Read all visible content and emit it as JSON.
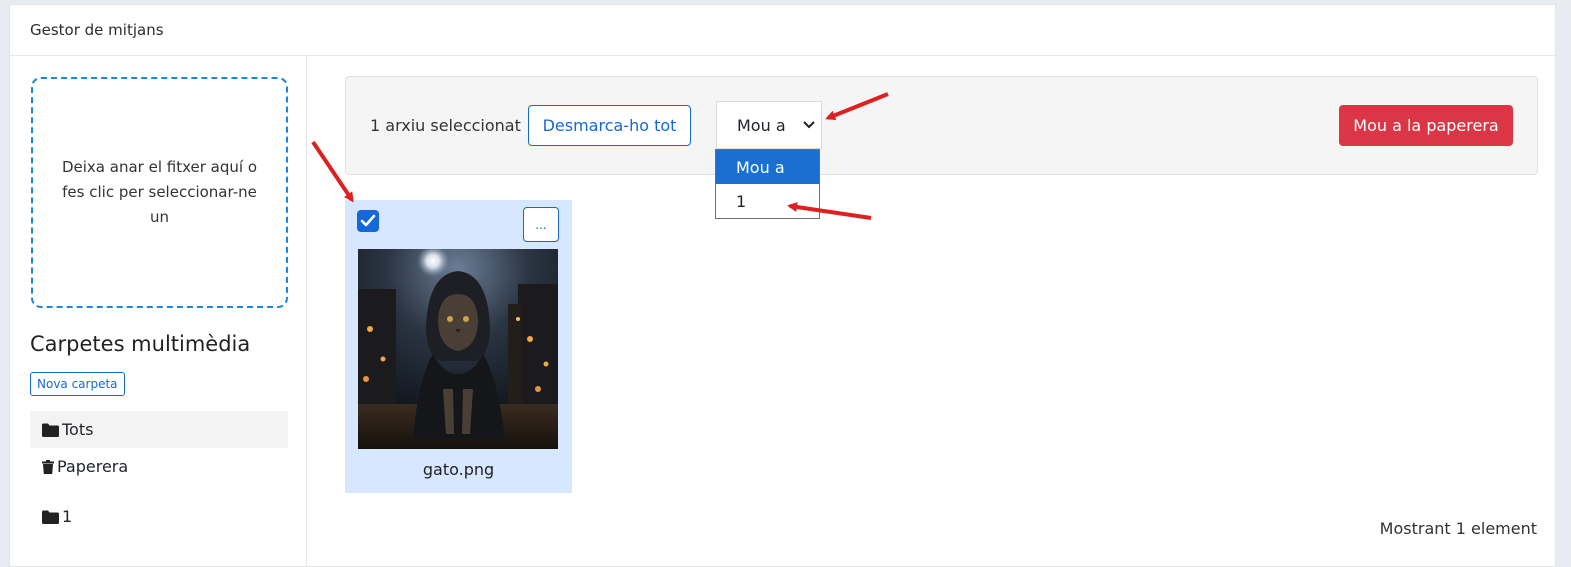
{
  "header": {
    "title": "Gestor de mitjans"
  },
  "sidebar": {
    "dropzone_text": "Deixa anar el fitxer aquí o fes clic per seleccionar-ne un",
    "folders_title": "Carpetes multimèdia",
    "new_folder_label": "Nova carpeta",
    "folders": [
      {
        "label": "Tots",
        "icon": "folder-icon",
        "active": true
      },
      {
        "label": "Paperera",
        "icon": "trash-icon",
        "active": false
      },
      {
        "label": "1",
        "icon": "folder-icon",
        "active": false
      }
    ]
  },
  "toolbar": {
    "selection_text": "1 arxiu seleccionat",
    "unselect_all_label": "Desmarca-ho tot",
    "move_to_label": "Mou a",
    "move_options": [
      "Mou a",
      "1"
    ],
    "trash_label": "Mou a la paperera"
  },
  "media": [
    {
      "name": "gato.png",
      "selected": true,
      "menu_label": "..."
    }
  ],
  "footer": {
    "count_text": "Mostrant 1 element"
  },
  "colors": {
    "primary": "#1668d8",
    "danger": "#dc3545",
    "selected_card": "#d7e7ff",
    "dropzone_border": "#1b86e0",
    "annotation_arrow": "#e02020"
  }
}
